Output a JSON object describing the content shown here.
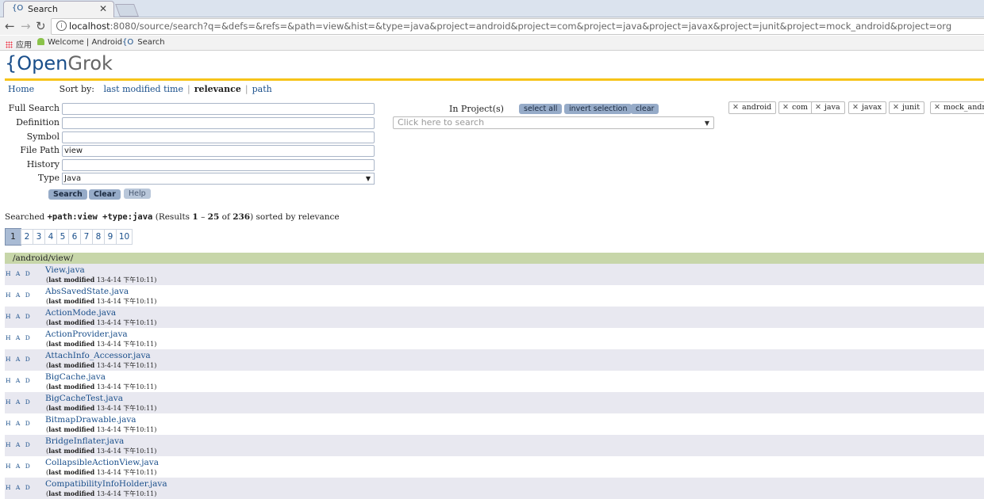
{
  "browser": {
    "tab_icon": "{O",
    "tab_title": "Search",
    "tab_close": "✕",
    "url_host": "localhost",
    "url_rest": ":8080/source/search?q=&defs=&refs=&path=view&hist=&type=java&project=android&project=com&project=java&project=javax&project=junit&project=mock_android&project=org",
    "bookmarks": [
      {
        "icon": "apps-icon",
        "label": "应用"
      },
      {
        "icon": "android-icon",
        "label": "Welcome | Android"
      },
      {
        "icon": "opengrok-icon",
        "label": "Search"
      }
    ]
  },
  "logo": {
    "brace": "{",
    "open": "Open",
    "grok": "Grok"
  },
  "menu": {
    "home": "Home",
    "sort_by": "Sort by:",
    "sort_options": [
      "last modified time",
      "relevance",
      "path"
    ]
  },
  "form": {
    "fields": [
      {
        "label": "Full  Search",
        "value": ""
      },
      {
        "label": "Definition",
        "value": ""
      },
      {
        "label": "Symbol",
        "value": ""
      },
      {
        "label": "File  Path",
        "value": "view"
      },
      {
        "label": "History",
        "value": ""
      }
    ],
    "type_label": "Type",
    "type_value": "Java",
    "buttons": {
      "search": "Search",
      "clear": "Clear",
      "help": "Help"
    }
  },
  "projects": {
    "label": "In Project(s)",
    "select_all": "select all",
    "invert": "invert selection",
    "clear": "clear",
    "placeholder": "Click here to search",
    "chips": [
      "android",
      "com",
      "java",
      "javax",
      "junit",
      "mock_andro"
    ]
  },
  "summary": {
    "prefix": "Searched",
    "query": "+path:view +type:java",
    "results_pre": "(Results",
    "from": "1",
    "dash": "–",
    "to": "25",
    "of": "of",
    "total": "236",
    "suffix": ") sorted by relevance"
  },
  "pager": [
    "1",
    "2",
    "3",
    "4",
    "5",
    "6",
    "7",
    "8",
    "9",
    "10"
  ],
  "results": {
    "directory": "/android/view/",
    "had": "H A D",
    "modified_label": "last modified",
    "files": [
      {
        "name": "View.java",
        "date": "13-4-14 下午10:11"
      },
      {
        "name": "AbsSavedState.java",
        "date": "13-4-14 下午10:11"
      },
      {
        "name": "ActionMode.java",
        "date": "13-4-14 下午10:11"
      },
      {
        "name": "ActionProvider.java",
        "date": "13-4-14 下午10:11"
      },
      {
        "name": "AttachInfo_Accessor.java",
        "date": "13-4-14 下午10:11"
      },
      {
        "name": "BigCache.java",
        "date": "13-4-14 下午10:11"
      },
      {
        "name": "BigCacheTest.java",
        "date": "13-4-14 下午10:11"
      },
      {
        "name": "BitmapDrawable.java",
        "date": "13-4-14 下午10:11"
      },
      {
        "name": "BridgeInflater.java",
        "date": "13-4-14 下午10:11"
      },
      {
        "name": "CollapsibleActionView.java",
        "date": "13-4-14 下午10:11"
      },
      {
        "name": "CompatibilityInfoHolder.java",
        "date": "13-4-14 下午10:11"
      }
    ]
  }
}
